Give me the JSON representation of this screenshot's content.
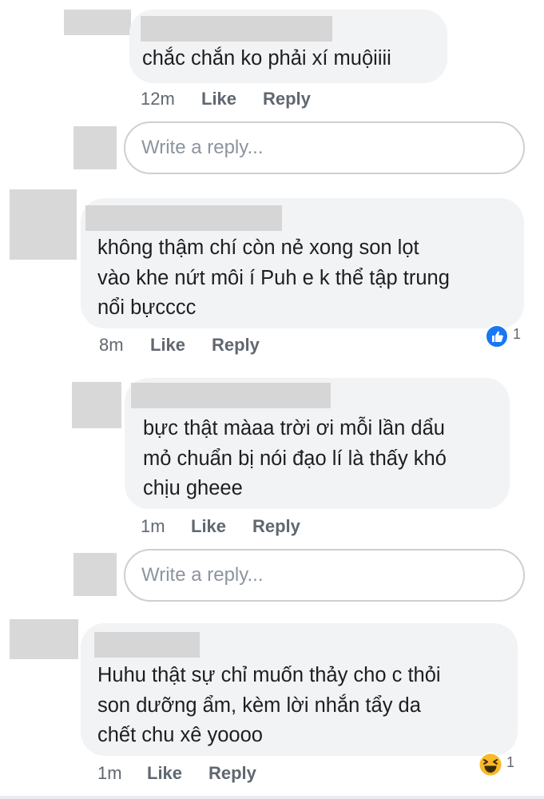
{
  "comments": [
    {
      "text": "chắc chắn ko phải xí muộiiii",
      "time": "12m",
      "like": "Like",
      "reply": "Reply"
    },
    {
      "text": "không thậm chí còn nẻ xong son lọt\nvào khe nứt môi í Puh e k thể tập trung\nnổi bựcccc",
      "time": "8m",
      "like": "Like",
      "reply": "Reply",
      "reaction_count": "1",
      "reaction_icon": "like-icon"
    },
    {
      "text": "bực thật màaa trời ơi mỗi lần dẩu\nmỏ chuẩn bị nói đạo lí là thấy khó\nchịu gheee",
      "time": "1m",
      "like": "Like",
      "reply": "Reply"
    },
    {
      "text": "Huhu thật sự chỉ muốn thảy cho c thỏi\nson dưỡng ẩm, kèm lời nhắn tẩy da\nchết chu xê yoooo",
      "time": "1m",
      "like": "Like",
      "reply": "Reply",
      "reaction_count": "1",
      "reaction_icon": "haha-icon"
    }
  ],
  "reply_inputs": [
    {
      "placeholder": "Write a reply..."
    },
    {
      "placeholder": "Write a reply..."
    }
  ],
  "colors": {
    "bubble": "#f2f3f5",
    "like_blue": "#1877f2",
    "haha_yellow": "#f7b928",
    "meta_text": "#606770"
  }
}
